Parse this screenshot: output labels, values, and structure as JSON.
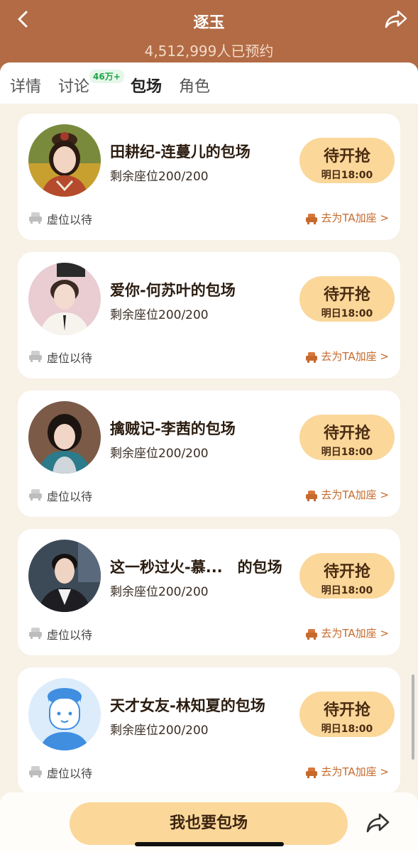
{
  "header": {
    "back_icon": "chevron-left-icon",
    "title": "逐玉",
    "subtitle": "4,512,999人已预约",
    "share_icon": "share-arrow-icon"
  },
  "tabs": [
    {
      "label": "详情",
      "active": false
    },
    {
      "label": "讨论",
      "active": false,
      "badge": "46万+"
    },
    {
      "label": "包场",
      "active": true
    },
    {
      "label": "角色",
      "active": false
    }
  ],
  "cards": [
    {
      "title": "田耕纪-连蔓儿的包场",
      "seats": "剩余座位200/200",
      "btn_main": "待开抢",
      "btn_sub": "明日18:00",
      "wait": "虚位以待",
      "add": "去为TA加座 >"
    },
    {
      "title": "爱你-何苏叶的包场",
      "seats": "剩余座位200/200",
      "btn_main": "待开抢",
      "btn_sub": "明日18:00",
      "wait": "虚位以待",
      "add": "去为TA加座 >"
    },
    {
      "title": "擒贼记-李茜的包场",
      "seats": "剩余座位200/200",
      "btn_main": "待开抢",
      "btn_sub": "明日18:00",
      "wait": "虚位以待",
      "add": "去为TA加座 >"
    },
    {
      "title": "这一秒过火-慕...　的包场",
      "seats": "剩余座位200/200",
      "btn_main": "待开抢",
      "btn_sub": "明日18:00",
      "wait": "虚位以待",
      "add": "去为TA加座 >"
    },
    {
      "title": "天才女友-林知夏的包场",
      "seats": "剩余座位200/200",
      "btn_main": "待开抢",
      "btn_sub": "明日18:00",
      "wait": "虚位以待",
      "add": "去为TA加座 >"
    }
  ],
  "bottom": {
    "book_label": "我也要包场",
    "share_icon": "share-arrow-icon"
  },
  "colors": {
    "header_bg": "#b26b45",
    "button_bg": "#fbd79a",
    "accent_orange": "#c56a2c",
    "badge_green": "#22a34a"
  }
}
